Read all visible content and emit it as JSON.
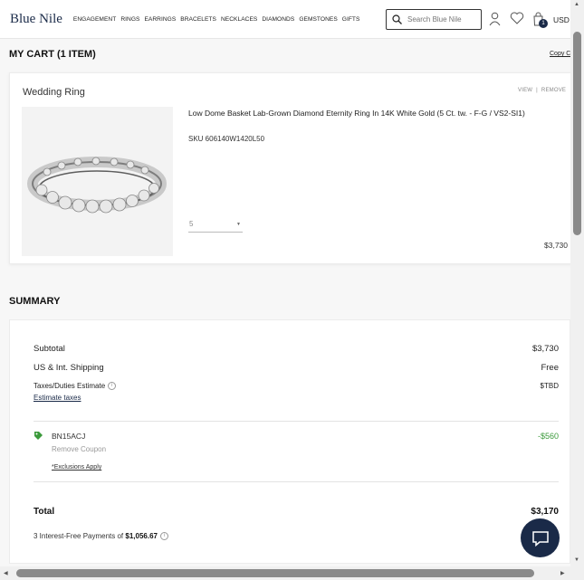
{
  "header": {
    "logo": "Blue Nile",
    "nav": [
      "ENGAGEMENT",
      "RINGS",
      "EARRINGS",
      "BRACELETS",
      "NECKLACES",
      "DIAMONDS",
      "GEMSTONES",
      "GIFTS"
    ],
    "search_placeholder": "Search Blue Nile",
    "cart_count": "1",
    "currency": "USD"
  },
  "cart": {
    "title": "MY CART (1 ITEM)",
    "copy_link": "Copy C",
    "item": {
      "type": "Wedding Ring",
      "view": "VIEW",
      "remove": "REMOVE",
      "name": "Low Dome Basket Lab-Grown Diamond Eternity Ring In 14K White Gold (5 Ct. tw. - F-G / VS2-SI1)",
      "sku": "SKU 606140W1420L50",
      "quantity": "5",
      "price": "$3,730"
    }
  },
  "summary": {
    "title": "SUMMARY",
    "subtotal_label": "Subtotal",
    "subtotal_value": "$3,730",
    "shipping_label": "US & Int. Shipping",
    "shipping_value": "Free",
    "taxes_label": "Taxes/Duties Estimate",
    "taxes_value": "$TBD",
    "estimate_link": "Estimate taxes",
    "coupon": {
      "code": "BN15ACJ",
      "remove": "Remove Coupon",
      "exclusions": "*Exclusions Apply",
      "value": "-$560",
      "color": "#3b9a3b"
    },
    "total_label": "Total",
    "total_value": "$3,170",
    "installment_prefix": "3 Interest-Free Payments of ",
    "installment_value": "$1,056.67"
  },
  "colors": {
    "brand": "#1a2a48",
    "accent_green": "#3b9a3b"
  }
}
